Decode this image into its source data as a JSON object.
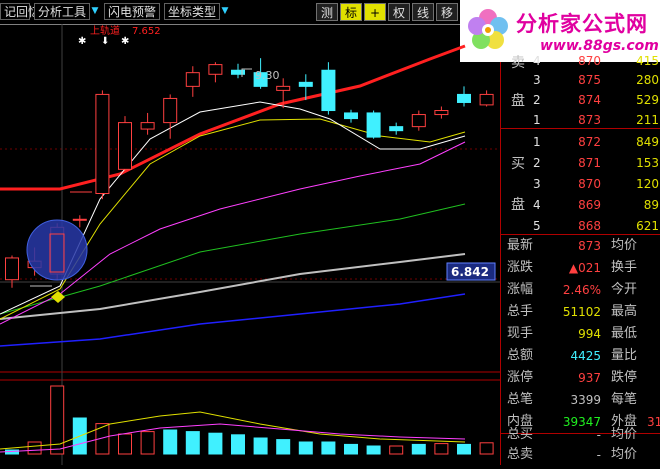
{
  "toolbar": {
    "memory_label": "记回忆",
    "analysis_tools_label": "分析工具",
    "flash_alert_label": "闪电预警",
    "coord_type_label": "坐标类型",
    "measure_label": "测",
    "mark_label": "标",
    "plus_label": "+",
    "rights_label": "权",
    "line_label": "线",
    "move_label": "移"
  },
  "logo": {
    "text": "分析家公式网",
    "url": "www.88gs.com"
  },
  "legend": {
    "band_label": "上轨道",
    "band_value": "7.652"
  },
  "annotations": {
    "peak_label": "9.30",
    "level_value": "6.842"
  },
  "order_book": {
    "sell_label_1": "卖",
    "sell_label_2": "盘",
    "buy_label_1": "买",
    "buy_label_2": "盘",
    "sell": [
      {
        "level": "4",
        "price": "870",
        "vol": "415"
      },
      {
        "level": "3",
        "price": "875",
        "vol": "280"
      },
      {
        "level": "2",
        "price": "874",
        "vol": "529"
      },
      {
        "level": "1",
        "price": "873",
        "vol": "211"
      }
    ],
    "buy": [
      {
        "level": "1",
        "price": "872",
        "vol": "849"
      },
      {
        "level": "2",
        "price": "871",
        "vol": "153"
      },
      {
        "level": "3",
        "price": "870",
        "vol": "120"
      },
      {
        "level": "4",
        "price": "869",
        "vol": "89"
      },
      {
        "level": "5",
        "price": "868",
        "vol": "621"
      }
    ]
  },
  "quote": {
    "latest_label": "最新",
    "latest_value": "873",
    "avg_label": "均价",
    "change_label": "涨跌",
    "change_value": "▲021",
    "turnover_label": "换手",
    "pct_label": "涨幅",
    "pct_value": "2.46%",
    "open_label": "今开",
    "total_hand_label": "总手",
    "total_hand_value": "51102",
    "high_label": "最高",
    "current_hand_label": "现手",
    "current_hand_value": "994",
    "low_label": "最低",
    "amount_label": "总额",
    "amount_value": "4425",
    "vol_ratio_label": "量比",
    "limit_up_label": "涨停",
    "limit_up_value": "937",
    "limit_down_label": "跌停",
    "total_trades_label": "总笔",
    "total_trades_value": "3399",
    "per_trade_label": "每笔",
    "inner_label": "内盘",
    "inner_value": "39347",
    "outer_label": "外盘",
    "outer_value": "31",
    "total_buy_label": "总买",
    "total_buy_value": "-",
    "buy_avg_label": "均价",
    "total_sell_label": "总卖",
    "total_sell_value": "-",
    "sell_avg_label": "均价"
  },
  "colors": {
    "up": "#ff4040",
    "down": "#40f0ff",
    "band": "#ff2020",
    "ma5": "#ffffff",
    "ma10": "#e0e000",
    "ma20": "#ff40ff",
    "ma30": "#20c020",
    "ma60": "#c0c0c0",
    "ma120": "#2020ff"
  },
  "chart_data": {
    "type": "candlestick",
    "candles": [
      {
        "o": 6.55,
        "h": 6.85,
        "l": 6.45,
        "c": 6.82
      },
      {
        "o": 6.7,
        "h": 6.95,
        "l": 6.6,
        "c": 6.78
      },
      {
        "o": 6.62,
        "h": 7.25,
        "l": 6.55,
        "c": 7.2
      },
      {
        "o": 7.3,
        "h": 7.35,
        "l": 7.2,
        "c": 7.3
      },
      {
        "o": 7.62,
        "h": 8.9,
        "l": 7.55,
        "c": 8.85
      },
      {
        "o": 7.92,
        "h": 8.58,
        "l": 7.9,
        "c": 8.5
      },
      {
        "o": 8.42,
        "h": 8.62,
        "l": 8.35,
        "c": 8.5
      },
      {
        "o": 8.5,
        "h": 8.85,
        "l": 8.3,
        "c": 8.8
      },
      {
        "o": 8.95,
        "h": 9.2,
        "l": 8.82,
        "c": 9.12
      },
      {
        "o": 9.1,
        "h": 9.25,
        "l": 9.0,
        "c": 9.22
      },
      {
        "o": 9.15,
        "h": 9.23,
        "l": 9.05,
        "c": 9.1
      },
      {
        "o": 9.12,
        "h": 9.3,
        "l": 8.92,
        "c": 8.95
      },
      {
        "o": 8.9,
        "h": 9.05,
        "l": 8.68,
        "c": 8.95
      },
      {
        "o": 9.0,
        "h": 9.1,
        "l": 8.78,
        "c": 8.95
      },
      {
        "o": 9.15,
        "h": 9.25,
        "l": 8.6,
        "c": 8.65
      },
      {
        "o": 8.62,
        "h": 8.66,
        "l": 8.5,
        "c": 8.55
      },
      {
        "o": 8.62,
        "h": 8.65,
        "l": 8.3,
        "c": 8.32
      },
      {
        "o": 8.45,
        "h": 8.5,
        "l": 8.35,
        "c": 8.4
      },
      {
        "o": 8.45,
        "h": 8.65,
        "l": 8.4,
        "c": 8.6
      },
      {
        "o": 8.6,
        "h": 8.7,
        "l": 8.55,
        "c": 8.65
      },
      {
        "o": 8.85,
        "h": 8.95,
        "l": 8.7,
        "c": 8.75
      },
      {
        "o": 8.72,
        "h": 8.9,
        "l": 8.7,
        "c": 8.85
      }
    ],
    "volume": [
      {
        "v": 0.5,
        "up": false
      },
      {
        "v": 1.5,
        "up": true
      },
      {
        "v": 8.5,
        "up": true
      },
      {
        "v": 4.5,
        "up": false
      },
      {
        "v": 3.8,
        "up": true
      },
      {
        "v": 2.5,
        "up": true
      },
      {
        "v": 2.8,
        "up": true
      },
      {
        "v": 3.0,
        "up": false
      },
      {
        "v": 2.8,
        "up": false
      },
      {
        "v": 2.6,
        "up": false
      },
      {
        "v": 2.4,
        "up": false
      },
      {
        "v": 2.0,
        "up": false
      },
      {
        "v": 1.8,
        "up": false
      },
      {
        "v": 1.5,
        "up": false
      },
      {
        "v": 1.5,
        "up": false
      },
      {
        "v": 1.2,
        "up": false
      },
      {
        "v": 1.0,
        "up": false
      },
      {
        "v": 1.0,
        "up": true
      },
      {
        "v": 1.2,
        "up": false
      },
      {
        "v": 1.3,
        "up": true
      },
      {
        "v": 1.2,
        "up": false
      },
      {
        "v": 1.4,
        "up": true
      }
    ],
    "ylim": [
      6.0,
      9.6
    ]
  }
}
